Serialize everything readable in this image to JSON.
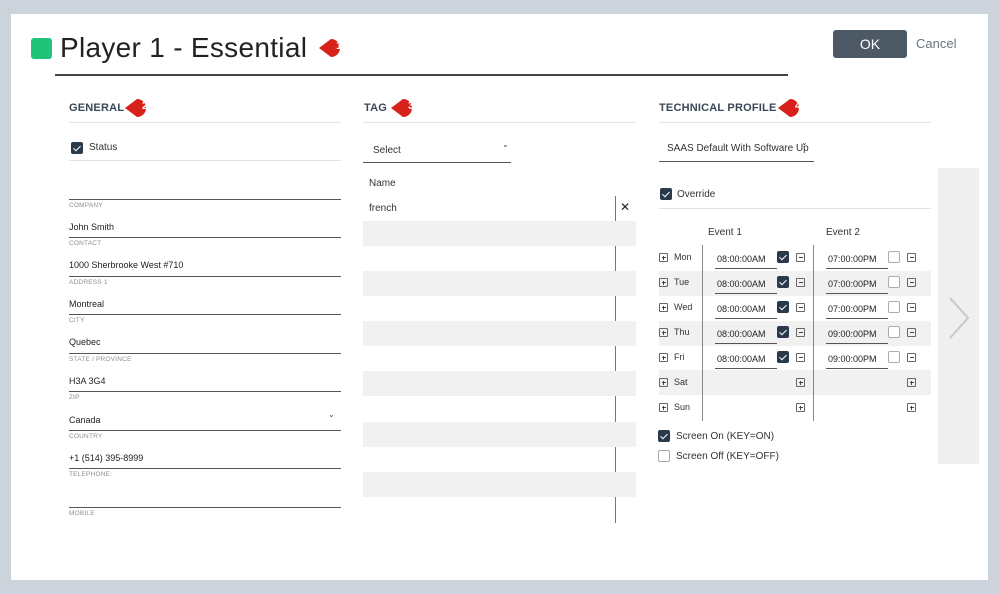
{
  "header": {
    "title": "Player 1 - Essential",
    "status_color": "#21c37a",
    "ok_label": "OK",
    "cancel_label": "Cancel",
    "markers": [
      "1",
      "2",
      "3",
      "4"
    ]
  },
  "general": {
    "title": "GENERAL",
    "status_label": "Status",
    "status_checked": true,
    "fields": [
      {
        "label": "COMPANY",
        "value": ""
      },
      {
        "label": "CONTACT",
        "value": "John Smith"
      },
      {
        "label": "ADDRESS 1",
        "value": "1000 Sherbrooke West #710"
      },
      {
        "label": "CITY",
        "value": "Montreal"
      },
      {
        "label": "STATE / PROVINCE",
        "value": "Quebec"
      },
      {
        "label": "ZIP",
        "value": "H3A 3G4"
      },
      {
        "label": "COUNTRY",
        "value": "Canada"
      },
      {
        "label": "TELEPHONE:",
        "value": "+1 (514) 395-8999"
      },
      {
        "label": "MOBILE",
        "value": ""
      }
    ]
  },
  "tag": {
    "title": "TAG",
    "select_placeholder": "Select",
    "column_header": "Name",
    "rows": [
      "french"
    ]
  },
  "technical_profile": {
    "title": "TECHNICAL PROFILE",
    "selected_profile": "SAAS Default With Software Upd",
    "override_label": "Override",
    "override_checked": true,
    "event1_label": "Event 1",
    "event2_label": "Event 2",
    "schedule": [
      {
        "day": "Mon",
        "e1": "08:00:00AM",
        "e1_on": true,
        "e2": "07:00:00PM",
        "e2_on": false
      },
      {
        "day": "Tue",
        "e1": "08:00:00AM",
        "e1_on": true,
        "e2": "07:00:00PM",
        "e2_on": false
      },
      {
        "day": "Wed",
        "e1": "08:00:00AM",
        "e1_on": true,
        "e2": "07:00:00PM",
        "e2_on": false
      },
      {
        "day": "Thu",
        "e1": "08:00:00AM",
        "e1_on": true,
        "e2": "09:00:00PM",
        "e2_on": false
      },
      {
        "day": "Fri",
        "e1": "08:00:00AM",
        "e1_on": true,
        "e2": "09:00:00PM",
        "e2_on": false
      },
      {
        "day": "Sat",
        "e1": "",
        "e1_on": null,
        "e2": "",
        "e2_on": null
      },
      {
        "day": "Sun",
        "e1": "",
        "e1_on": null,
        "e2": "",
        "e2_on": null
      }
    ],
    "screen_on_label": "Screen On (KEY=ON)",
    "screen_on_checked": true,
    "screen_off_label": "Screen Off (KEY=OFF)",
    "screen_off_checked": false
  },
  "icons": {
    "select_chevron": "chevron-down-icon",
    "remove_tag": "close-icon",
    "next": "chevron-right-icon",
    "add": "plus-square-icon",
    "remove": "minus-square-icon"
  }
}
